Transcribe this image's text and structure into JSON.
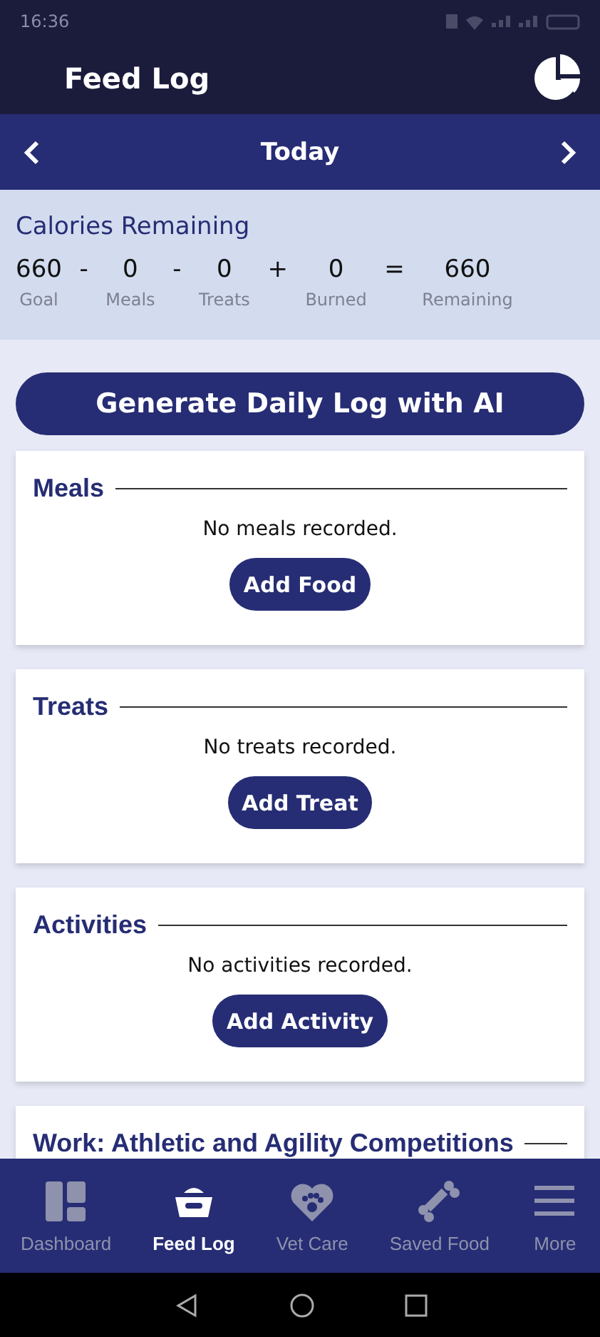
{
  "status_bar": {
    "time": "16:36"
  },
  "header": {
    "title": "Feed Log"
  },
  "date_nav": {
    "label": "Today"
  },
  "calories": {
    "title": "Calories Remaining",
    "items": [
      {
        "kind": "term",
        "value": "660",
        "label": "Goal"
      },
      {
        "kind": "operator",
        "symbol": "-"
      },
      {
        "kind": "term",
        "value": "0",
        "label": "Meals"
      },
      {
        "kind": "operator",
        "symbol": "-"
      },
      {
        "kind": "term",
        "value": "0",
        "label": "Treats"
      },
      {
        "kind": "operator",
        "symbol": "+"
      },
      {
        "kind": "term",
        "value": "0",
        "label": "Burned"
      },
      {
        "kind": "operator",
        "symbol": "="
      },
      {
        "kind": "term",
        "value": "660",
        "label": "Remaining"
      }
    ]
  },
  "generate_button": "Generate Daily Log with AI",
  "sections": [
    {
      "title": "Meals",
      "empty_text": "No meals recorded.",
      "button": "Add Food"
    },
    {
      "title": "Treats",
      "empty_text": "No treats recorded.",
      "button": "Add Treat"
    },
    {
      "title": "Activities",
      "empty_text": "No activities recorded.",
      "button": "Add Activity"
    },
    {
      "title": "Work: Athletic and Agility Competitions"
    }
  ],
  "bottom_nav": [
    {
      "kind": "dashboard",
      "label": "Dashboard",
      "selected": false
    },
    {
      "kind": "bowl",
      "label": "Feed Log",
      "selected": true
    },
    {
      "kind": "heart",
      "label": "Vet Care",
      "selected": false
    },
    {
      "kind": "bone",
      "label": "Saved Food",
      "selected": false
    },
    {
      "kind": "menu",
      "label": "More",
      "selected": false
    }
  ]
}
